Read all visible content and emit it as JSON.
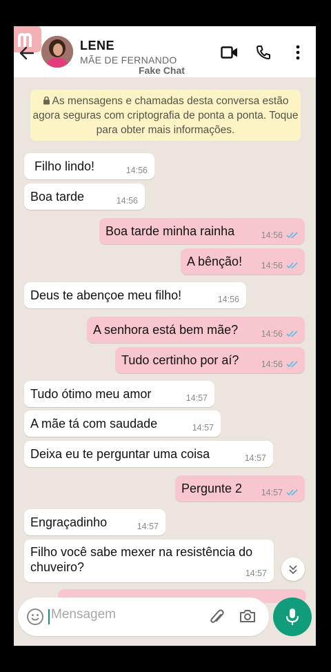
{
  "header": {
    "contact_name": "LENE",
    "contact_subtitle": "MÃE DE FERNANDO",
    "watermark": "Fake Chat"
  },
  "notice": {
    "text": "As mensagens e chamadas desta conversa estão agora seguras com criptografia de ponta a ponta. Toque para obter mais informações."
  },
  "messages": [
    {
      "dir": "in",
      "text": "Filho lindo!",
      "time": "14:56"
    },
    {
      "dir": "in",
      "text": "Boa tarde",
      "time": "14:56"
    },
    {
      "dir": "out",
      "text": "Boa tarde minha rainha",
      "time": "14:56",
      "read": true
    },
    {
      "dir": "out",
      "text": "A bênção!",
      "time": "14:56",
      "read": true
    },
    {
      "dir": "in",
      "text": "Deus te abençoe meu filho!",
      "time": "14:56"
    },
    {
      "dir": "out",
      "text": "A senhora está bem mãe?",
      "time": "14:56",
      "read": true
    },
    {
      "dir": "out",
      "text": "Tudo certinho por aí?",
      "time": "14:56",
      "read": true
    },
    {
      "dir": "in",
      "text": "Tudo ótimo meu amor",
      "time": "14:57"
    },
    {
      "dir": "in",
      "text": "A mãe tá com saudade",
      "time": "14:57"
    },
    {
      "dir": "in",
      "text": "Deixa eu te perguntar uma coisa",
      "time": "14:57"
    },
    {
      "dir": "out",
      "text": "Pergunte 2",
      "time": "14:57",
      "read": true
    },
    {
      "dir": "in",
      "text": "Engraçadinho",
      "time": "14:57"
    },
    {
      "dir": "in",
      "text": "Filho você sabe mexer na resistência do chuveiro?",
      "time": "14:57"
    }
  ],
  "composer": {
    "placeholder": "Mensagem"
  },
  "colors": {
    "outgoing_bubble": "#f7c6cf",
    "incoming_bubble": "#ffffff",
    "chat_background": "#ece5dd",
    "accent": "#0f9d7c",
    "read_ticks": "#53bdeb"
  }
}
